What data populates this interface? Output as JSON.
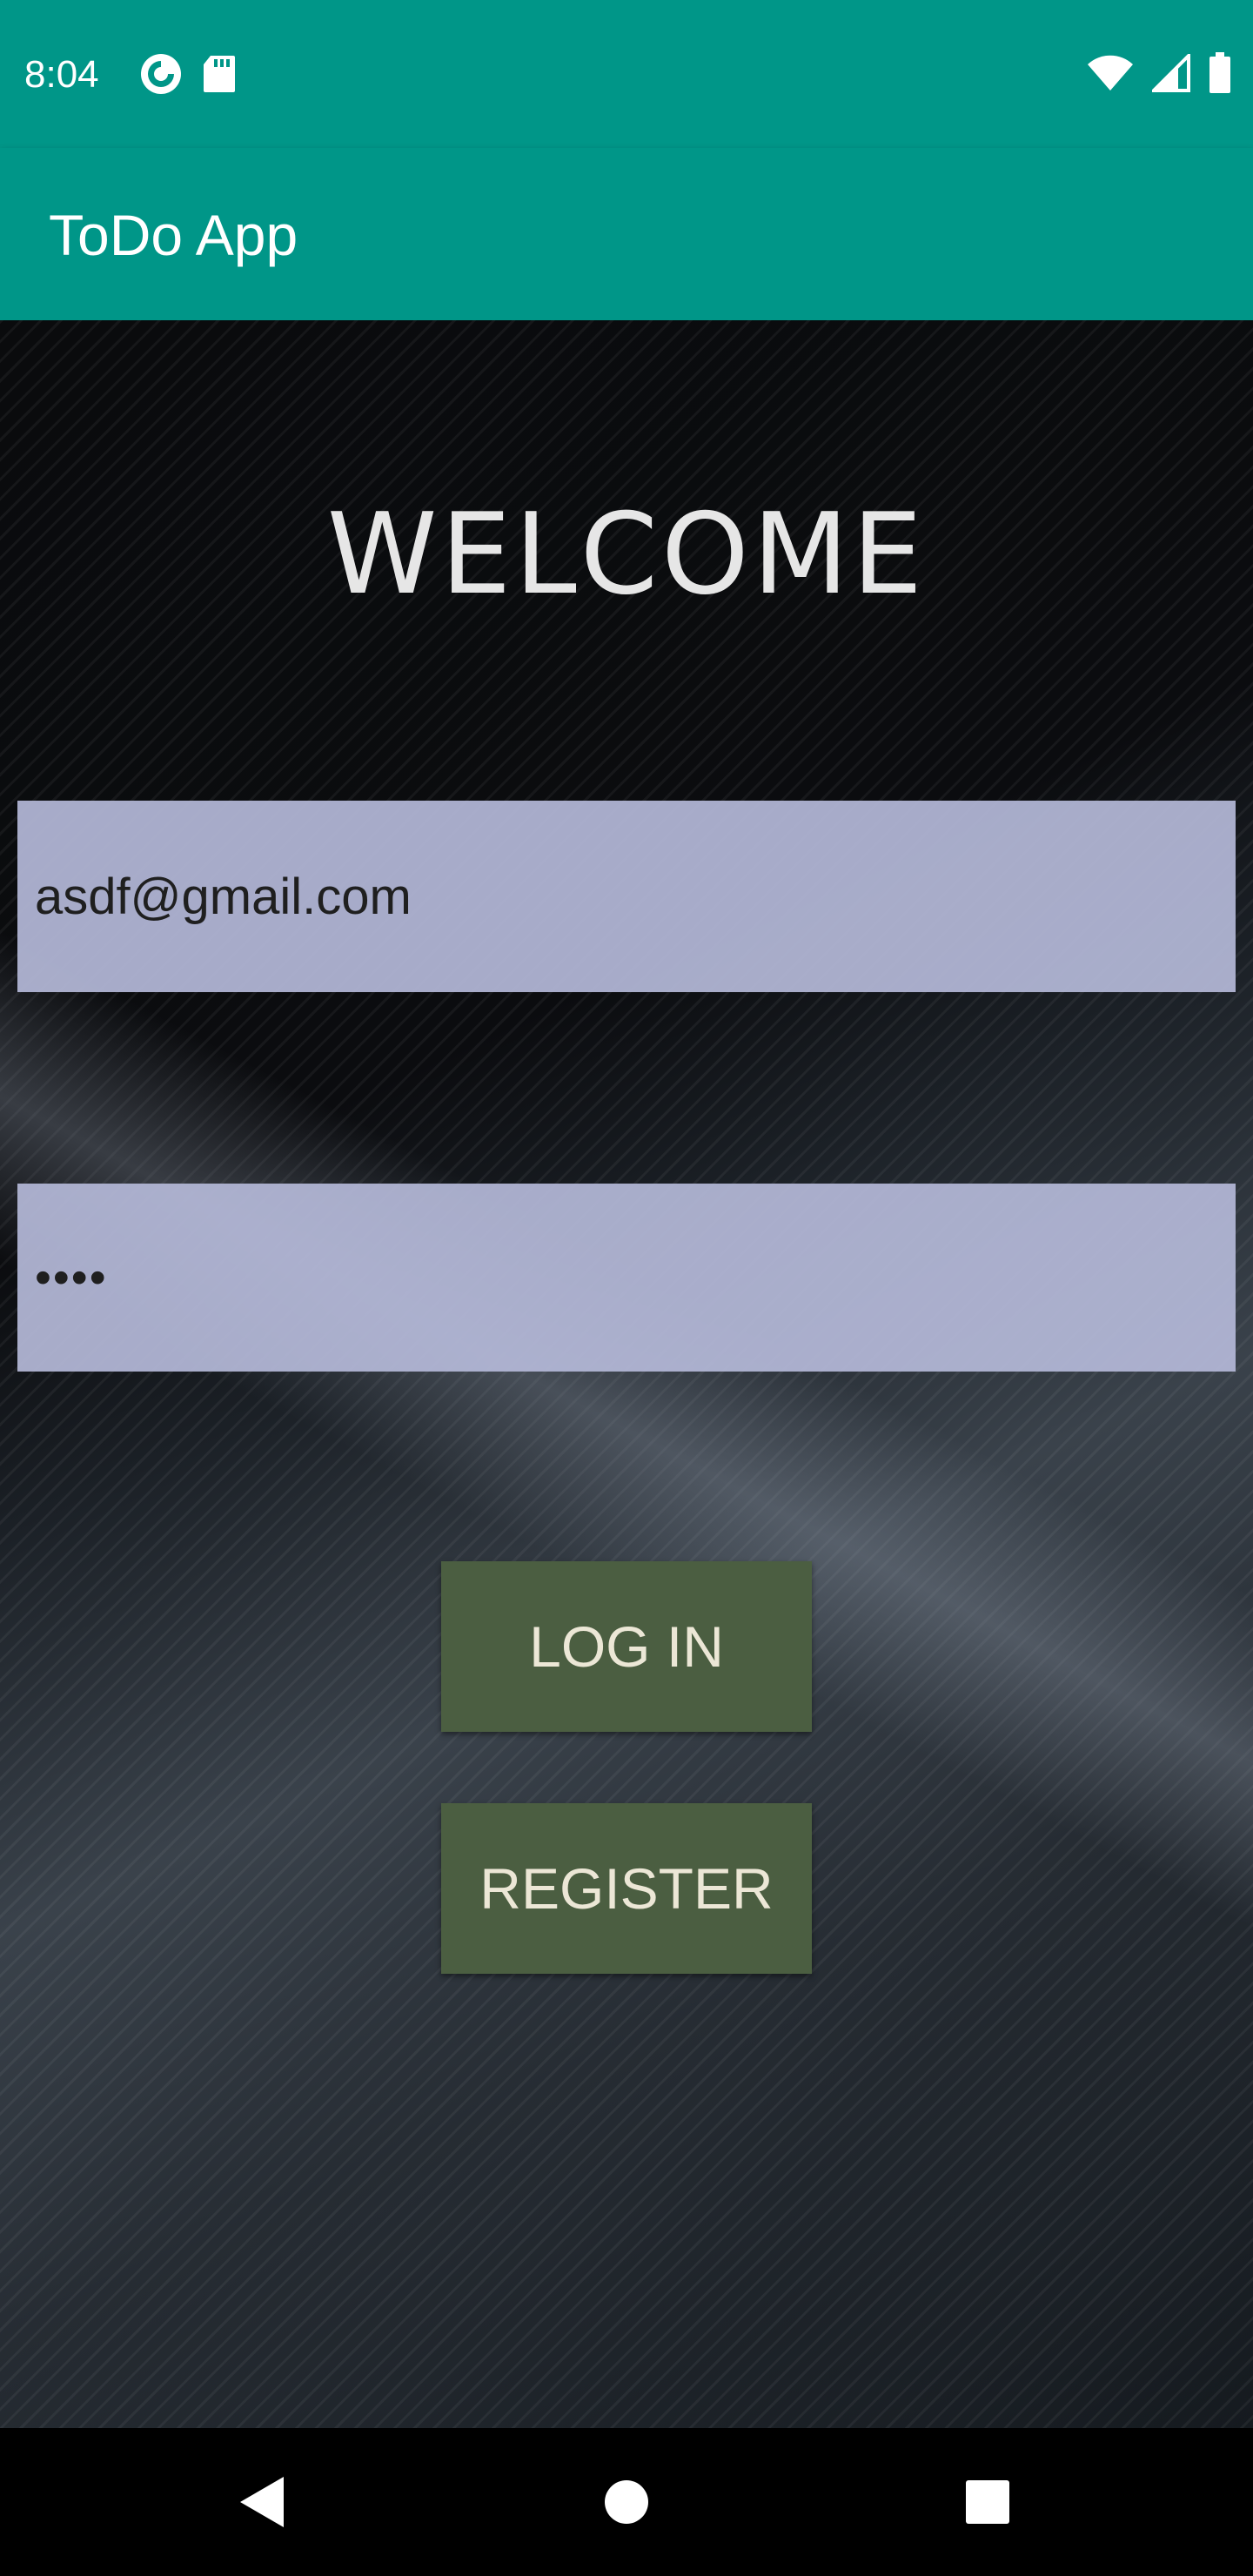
{
  "status_bar": {
    "time": "8:04",
    "icons_left": [
      "pocket-casts-icon",
      "sd-card-icon"
    ],
    "icons_right": [
      "wifi-icon",
      "cell-signal-icon",
      "battery-icon"
    ]
  },
  "app_bar": {
    "title": "ToDo App",
    "color": "#009688"
  },
  "main": {
    "heading": "WELCOME",
    "email_value": "asdf@gmail.com",
    "password_masked": "••••",
    "login_label": "LOG IN",
    "register_label": "REGISTER",
    "button_color": "#4b5e41",
    "field_color": "#b4b8d7"
  },
  "nav_bar": {
    "buttons": [
      "back-icon",
      "home-icon",
      "recents-icon"
    ]
  }
}
